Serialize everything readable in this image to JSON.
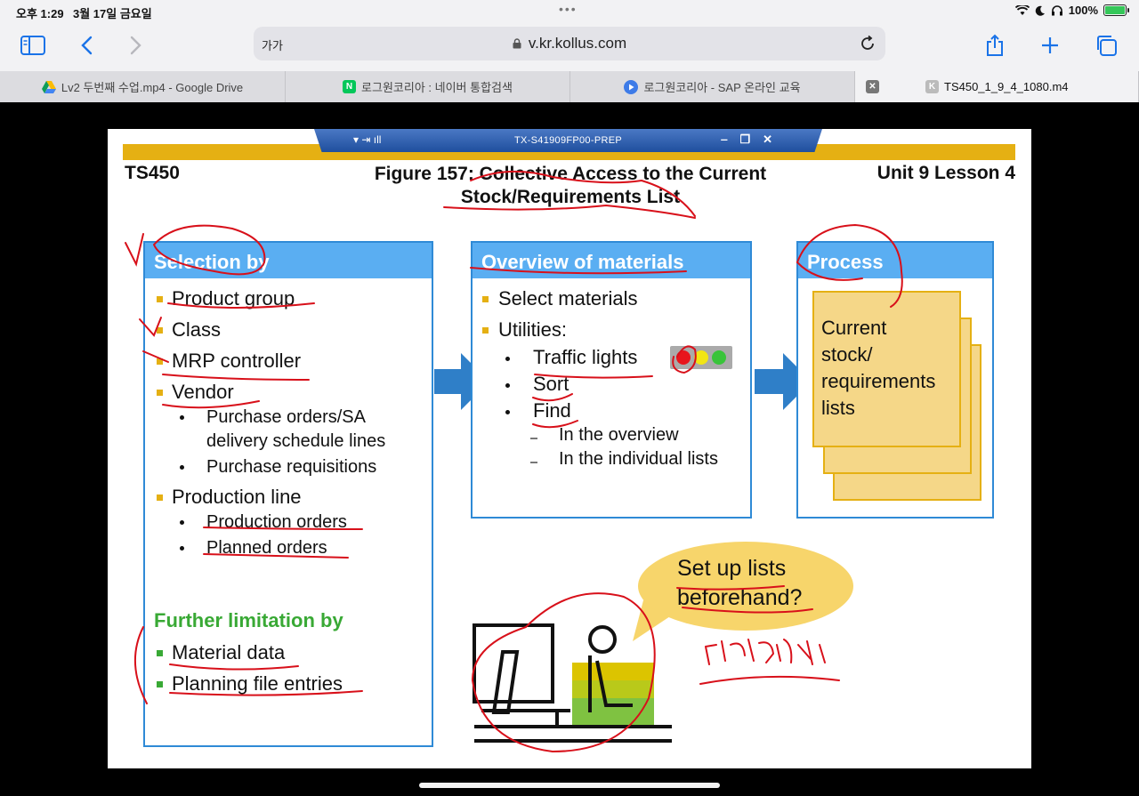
{
  "status": {
    "time": "오후 1:29",
    "date": "3월 17일 금요일",
    "battery": "100%"
  },
  "toolbar": {
    "text_size": "가가",
    "url": "v.kr.kollus.com"
  },
  "tabs": [
    {
      "label": "Lv2 두번째 수업.mp4 - Google Drive"
    },
    {
      "label": "로그원코리아 : 네이버 통합검색"
    },
    {
      "label": "로그원코리아 - SAP 온라인 교육"
    },
    {
      "label": "TS450_1_9_4_1080.m4"
    }
  ],
  "slide": {
    "system_bar": "TX-S41909FP00-PREP",
    "course": "TS450",
    "title_line1": "Figure 157: Collective Access to the Current",
    "title_line2": "Stock/Requirements List",
    "unit": "Unit 9 Lesson 4",
    "selection": {
      "heading": "Selection by",
      "product_group": "Product group",
      "class": "Class",
      "mrp_controller": "MRP controller",
      "vendor": "Vendor",
      "po_line1": "Purchase orders/SA",
      "po_line2": "delivery schedule lines",
      "purchase_requisitions": "Purchase requisitions",
      "production_line": "Production line",
      "production_orders": "Production orders",
      "planned_orders": "Planned orders",
      "further_heading": "Further limitation by",
      "material_data": "Material data",
      "planning_file": "Planning file entries"
    },
    "overview": {
      "heading": "Overview of materials",
      "select_materials": "Select materials",
      "utilities": "Utilities:",
      "traffic_lights": "Traffic lights",
      "sort": "Sort",
      "find": "Find",
      "in_overview": "In the overview",
      "in_individual": "In the individual lists"
    },
    "process": {
      "heading": "Process",
      "line1": "Current",
      "line2": "stock/",
      "line3": "requirements",
      "line4": "lists"
    },
    "bubble": {
      "line1": "Set up lists",
      "line2": "beforehand?"
    }
  },
  "colors": {
    "box_border": "#2f8ad6",
    "box_header": "#5aaef2",
    "gold": "#e5b013",
    "green": "#39a935",
    "arrow": "#2f7fc8",
    "ink": "#d8101a"
  }
}
